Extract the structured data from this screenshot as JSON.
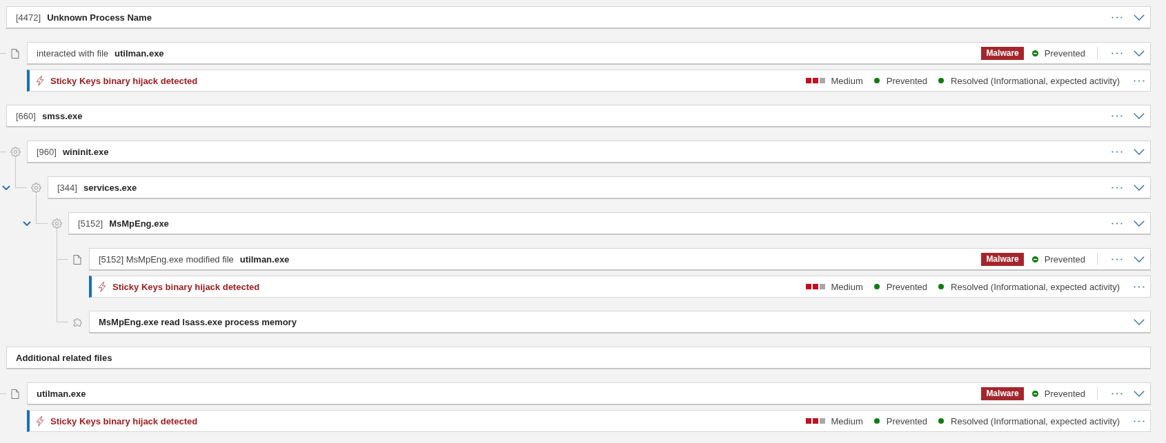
{
  "tree": [
    {
      "kind": "process",
      "pid": "[4472]",
      "name": "Unknown Process Name",
      "more_button": true,
      "expand_button": true,
      "children": [
        {
          "kind": "file",
          "action": "interacted with file",
          "target": "utilman.exe",
          "badge": "Malware",
          "status": "Prevented",
          "more_button": true,
          "expand_button": true,
          "alert": {
            "title": "Sticky Keys binary hijack detected",
            "severity": {
              "stars": 2,
              "label": "Medium"
            },
            "statuses": [
              "Prevented",
              "Resolved (Informational, expected activity)"
            ],
            "more_button": true
          }
        }
      ]
    },
    {
      "kind": "process",
      "pid": "[660]",
      "name": "smss.exe",
      "more_button": true,
      "expand_button": true,
      "children": [
        {
          "kind": "process",
          "pid": "[960]",
          "name": "wininit.exe",
          "more_button": true,
          "expand_button": true,
          "children": [
            {
              "kind": "process",
              "pid": "[344]",
              "name": "services.exe",
              "expanded": true,
              "more_button": true,
              "expand_button": true,
              "children": [
                {
                  "kind": "process",
                  "pid": "[5152]",
                  "name": "MsMpEng.exe",
                  "expanded": true,
                  "more_button": true,
                  "expand_button": true,
                  "children": [
                    {
                      "kind": "file",
                      "action": "[5152] MsMpEng.exe modified file",
                      "target": "utilman.exe",
                      "badge": "Malware",
                      "status": "Prevented",
                      "more_button": true,
                      "expand_button": true,
                      "alert": {
                        "title": "Sticky Keys binary hijack detected",
                        "severity": {
                          "stars": 2,
                          "label": "Medium"
                        },
                        "statuses": [
                          "Prevented",
                          "Resolved (Informational, expected activity)"
                        ],
                        "more_button": true
                      }
                    },
                    {
                      "kind": "event",
                      "text": "MsMpEng.exe read lsass.exe process memory",
                      "more_button": false,
                      "expand_button": true
                    }
                  ]
                }
              ]
            }
          ]
        }
      ]
    },
    {
      "kind": "header",
      "text": "Additional related files",
      "more_button": false,
      "expand_button": false,
      "children": [
        {
          "kind": "file",
          "target": "utilman.exe",
          "badge": "Malware",
          "status": "Prevented",
          "more_button": true,
          "expand_button": true,
          "alert": {
            "title": "Sticky Keys binary hijack detected",
            "severity": {
              "stars": 2,
              "label": "Medium"
            },
            "statuses": [
              "Prevented",
              "Resolved (Informational, expected activity)"
            ],
            "more_button": true
          }
        }
      ]
    }
  ]
}
